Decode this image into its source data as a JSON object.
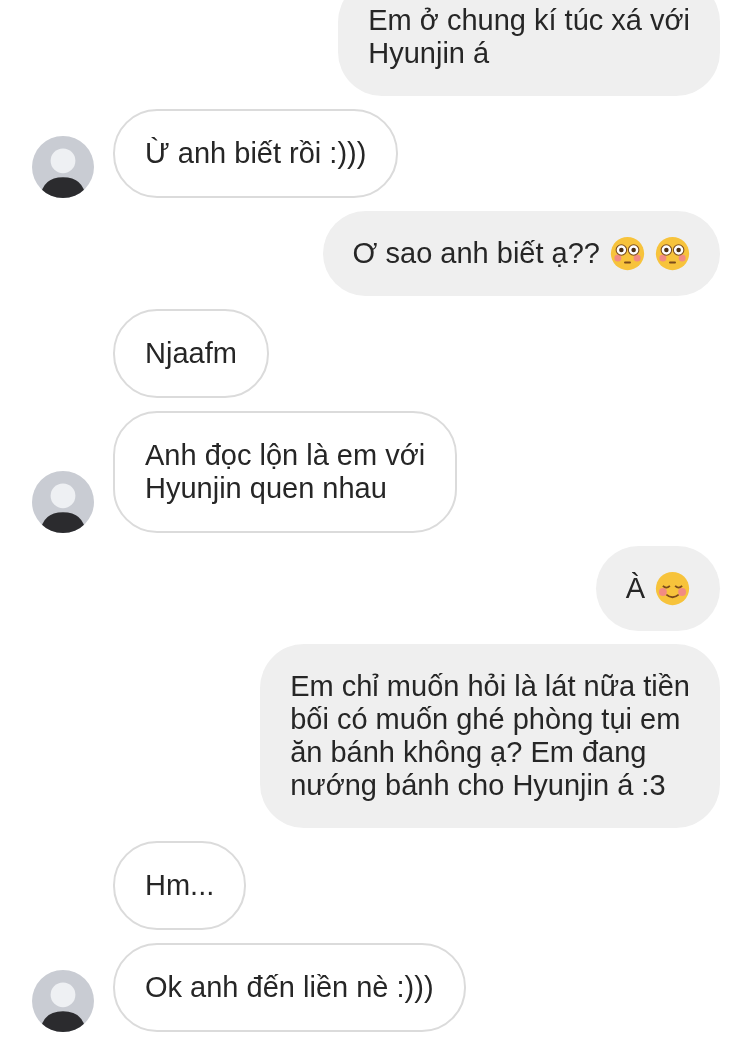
{
  "messages": [
    {
      "kind": "sent",
      "text": "Em ở chung kí túc xá với\nHyunjin á"
    },
    {
      "kind": "received",
      "avatar": true,
      "text": "Ừ anh biết rồi :)))"
    },
    {
      "kind": "sent",
      "text": "Ơ sao anh biết ạ??",
      "emoji": [
        {
          "kind": "flushed"
        },
        {
          "kind": "flushed"
        }
      ]
    },
    {
      "kind": "received",
      "avatar": false,
      "text": "Njaafm"
    },
    {
      "kind": "received",
      "avatar": true,
      "text": "Anh đọc lộn là em với\nHyunjin quen nhau"
    },
    {
      "kind": "sent",
      "text": "À",
      "emoji": [
        {
          "kind": "smiling"
        }
      ]
    },
    {
      "kind": "sent",
      "text": "Em chỉ muốn hỏi là lát nữa tiền\nbối có muốn ghé phòng tụi em\năn bánh không ạ? Em đang\nnướng bánh cho Hyunjin á :3"
    },
    {
      "kind": "received",
      "avatar": false,
      "text": "Hm..."
    },
    {
      "kind": "received",
      "avatar": true,
      "text": "Ok anh đến liền nè :)))"
    }
  ]
}
